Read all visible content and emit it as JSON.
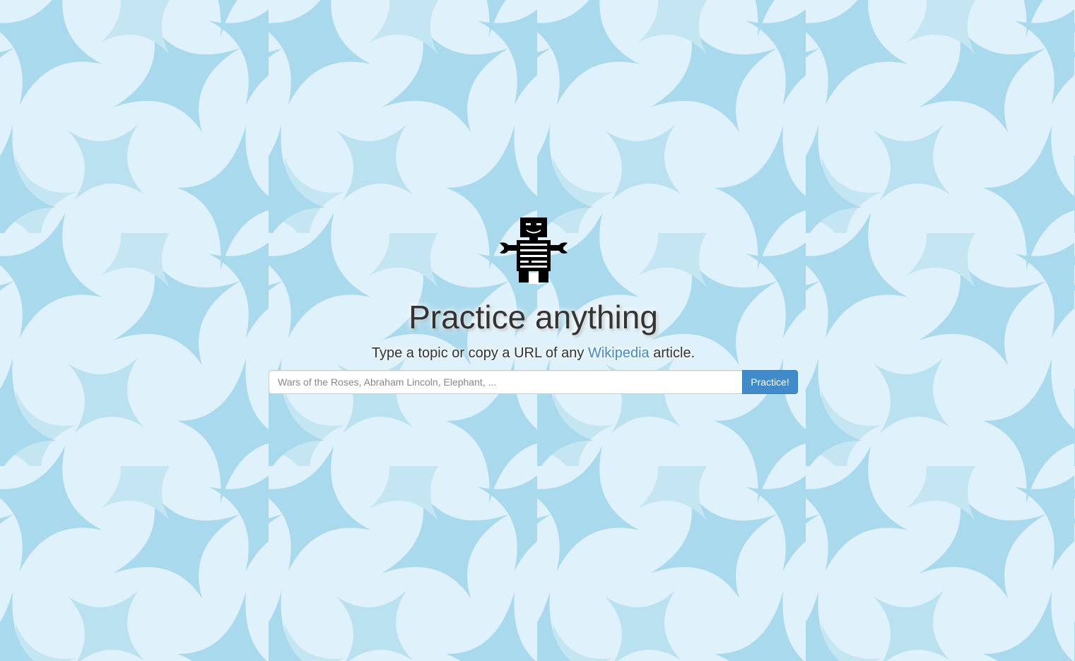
{
  "hero": {
    "logo_icon": "robot-icon",
    "title": "Practice anything",
    "subtitle_before": "Type a topic or copy a URL of any ",
    "subtitle_link": "Wikipedia",
    "subtitle_after": " article."
  },
  "search": {
    "placeholder": "Wars of the Roses, Abraham Lincoln, Elephant, ...",
    "value": "",
    "button_label": "Practice!"
  },
  "colors": {
    "background": "#dff1fa",
    "pattern_star": "#a9d9ec",
    "accent": "#428bca",
    "text": "#333333"
  }
}
